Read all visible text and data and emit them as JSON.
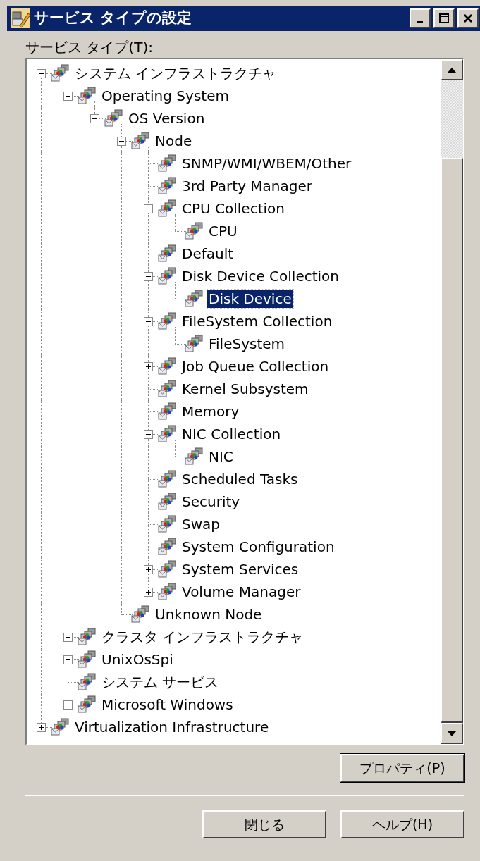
{
  "window": {
    "title": "サービス タイプの設定"
  },
  "tree": {
    "label": "サービス タイプ(T):",
    "items": [
      {
        "label": "システム インフラストラクチャ",
        "kind": "branch",
        "expanded": true,
        "selected": false,
        "children": [
          {
            "label": "Operating System",
            "kind": "branch",
            "expanded": true,
            "selected": false,
            "children": [
              {
                "label": "OS Version",
                "kind": "branch",
                "expanded": true,
                "selected": false,
                "children": [
                  {
                    "label": "Node",
                    "kind": "branch",
                    "expanded": true,
                    "selected": false,
                    "children": [
                      {
                        "label": "SNMP/WMI/WBEM/Other",
                        "kind": "leaf",
                        "selected": false
                      },
                      {
                        "label": "3rd Party Manager",
                        "kind": "leaf",
                        "selected": false
                      },
                      {
                        "label": "CPU Collection",
                        "kind": "branch",
                        "expanded": true,
                        "selected": false,
                        "children": [
                          {
                            "label": "CPU",
                            "kind": "leaf",
                            "selected": false
                          }
                        ]
                      },
                      {
                        "label": "Default",
                        "kind": "leaf",
                        "selected": false
                      },
                      {
                        "label": "Disk Device Collection",
                        "kind": "branch",
                        "expanded": true,
                        "selected": false,
                        "children": [
                          {
                            "label": "Disk Device",
                            "kind": "leaf",
                            "selected": true
                          }
                        ]
                      },
                      {
                        "label": "FileSystem Collection",
                        "kind": "branch",
                        "expanded": true,
                        "selected": false,
                        "children": [
                          {
                            "label": "FileSystem",
                            "kind": "leaf",
                            "selected": false
                          }
                        ]
                      },
                      {
                        "label": "Job Queue Collection",
                        "kind": "branch",
                        "expanded": false,
                        "selected": false
                      },
                      {
                        "label": "Kernel Subsystem",
                        "kind": "leaf",
                        "selected": false
                      },
                      {
                        "label": "Memory",
                        "kind": "leaf",
                        "selected": false
                      },
                      {
                        "label": "NIC Collection",
                        "kind": "branch",
                        "expanded": true,
                        "selected": false,
                        "children": [
                          {
                            "label": "NIC",
                            "kind": "leaf",
                            "selected": false
                          }
                        ]
                      },
                      {
                        "label": "Scheduled Tasks",
                        "kind": "leaf",
                        "selected": false
                      },
                      {
                        "label": "Security",
                        "kind": "leaf",
                        "selected": false
                      },
                      {
                        "label": "Swap",
                        "kind": "leaf",
                        "selected": false
                      },
                      {
                        "label": "System Configuration",
                        "kind": "leaf",
                        "selected": false
                      },
                      {
                        "label": "System Services",
                        "kind": "branch",
                        "expanded": false,
                        "selected": false
                      },
                      {
                        "label": "Volume Manager",
                        "kind": "branch",
                        "expanded": false,
                        "selected": false
                      }
                    ]
                  },
                  {
                    "label": "Unknown Node",
                    "kind": "leaf",
                    "selected": false
                  }
                ]
              }
            ]
          },
          {
            "label": "クラスタ インフラストラクチャ",
            "kind": "branch",
            "expanded": false,
            "selected": false
          },
          {
            "label": "UnixOsSpi",
            "kind": "branch",
            "expanded": false,
            "selected": false
          },
          {
            "label": "システム サービス",
            "kind": "leaf",
            "selected": false
          },
          {
            "label": "Microsoft Windows",
            "kind": "branch",
            "expanded": false,
            "selected": false
          }
        ]
      },
      {
        "label": "Virtualization Infrastructure",
        "kind": "branch",
        "expanded": false,
        "selected": false
      }
    ]
  },
  "buttons": {
    "properties": "プロパティ(P)",
    "close": "閉じる",
    "help": "ヘルプ(H)"
  }
}
